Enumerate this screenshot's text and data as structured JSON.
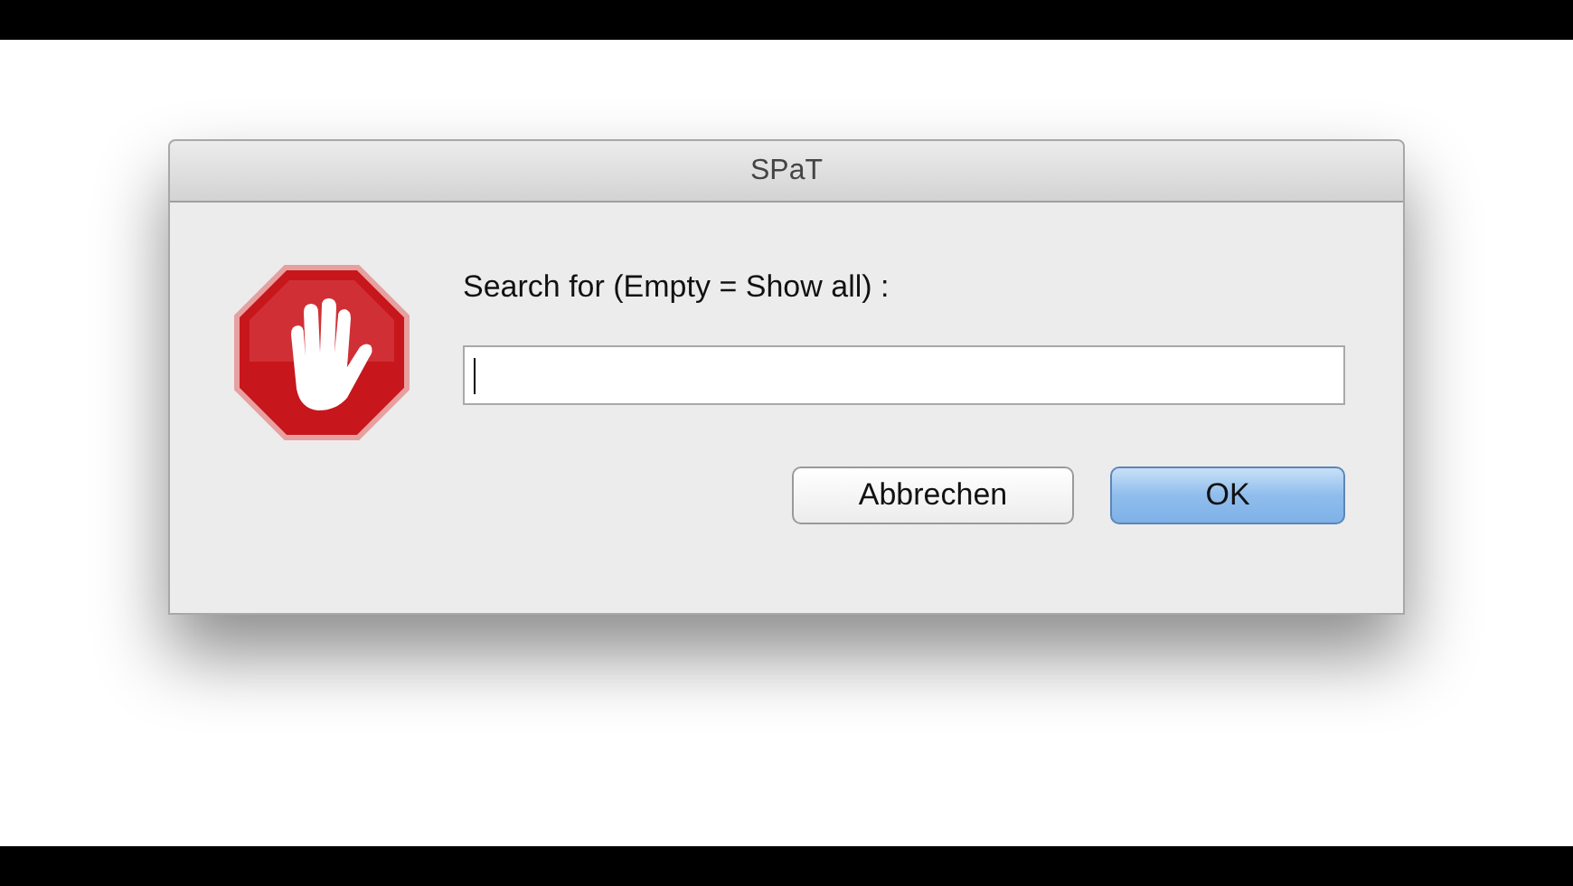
{
  "window": {
    "title": "SPaT"
  },
  "prompt": "Search for (Empty = Show all) :",
  "search_field": {
    "focused": true
  },
  "buttons": [
    {
      "label": "Abbrechen",
      "default": false
    },
    {
      "label": "OK",
      "default": true
    }
  ]
}
